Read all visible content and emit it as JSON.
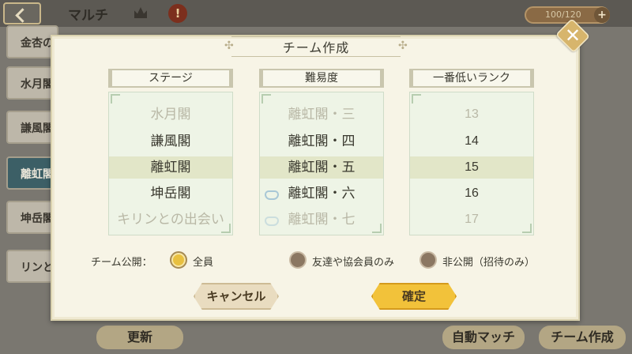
{
  "background": {
    "title": "マルチ",
    "warn_glyph": "!",
    "stamina": "100/120",
    "plus_glyph": "+",
    "side_items": [
      "金杏の",
      "水月閣",
      "謙風閣",
      "離虹閣",
      "坤岳閣",
      "リンとの"
    ],
    "bottom_buttons": [
      "更新",
      "自動マッチ",
      "チーム作成"
    ]
  },
  "dialog": {
    "title": "チーム作成",
    "close_glyph": "✕",
    "title_ornament": "✣",
    "columns": {
      "stage": {
        "header": "ステージ",
        "items": [
          "水月閣",
          "謙風閣",
          "離虹閣",
          "坤岳閣",
          "キリンとの出会い"
        ]
      },
      "difficulty": {
        "header": "難易度",
        "items": [
          "離虹閣・三",
          "離虹閣・四",
          "離虹閣・五",
          "離虹閣・六",
          "離虹閣・七"
        ]
      },
      "min_rank": {
        "header": "一番低いランク",
        "items": [
          "13",
          "14",
          "15",
          "16",
          "17"
        ]
      }
    },
    "visibility": {
      "label": "チーム公開：",
      "options": [
        "全員",
        "友達や協会員のみ",
        "非公開（招待のみ）"
      ],
      "selected": "全員"
    },
    "cancel_label": "キャンセル",
    "confirm_label": "確定"
  },
  "colors": {
    "accent": "#f2c23a",
    "dialog_bg": "#f7f4e6",
    "selection_band": "#e2e6c8"
  }
}
